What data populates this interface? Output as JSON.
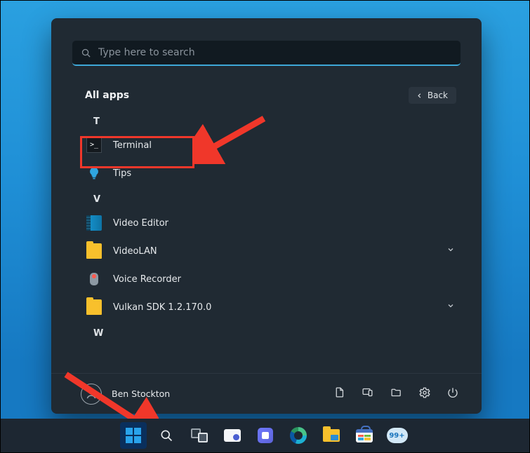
{
  "search": {
    "placeholder": "Type here to search"
  },
  "heading": "All apps",
  "back_label": "Back",
  "sections": {
    "t": {
      "letter": "T",
      "items": [
        {
          "name": "Terminal",
          "icon": "terminal-icon"
        },
        {
          "name": "Tips",
          "icon": "tips-icon"
        }
      ]
    },
    "v": {
      "letter": "V",
      "items": [
        {
          "name": "Video Editor",
          "icon": "video-editor-icon"
        },
        {
          "name": "VideoLAN",
          "icon": "folder-icon",
          "expandable": true
        },
        {
          "name": "Voice Recorder",
          "icon": "voice-recorder-icon"
        },
        {
          "name": "Vulkan SDK 1.2.170.0",
          "icon": "folder-icon",
          "expandable": true
        }
      ]
    },
    "w": {
      "letter": "W"
    }
  },
  "user": {
    "name": "Ben Stockton"
  },
  "footer_icons": [
    "documents-icon",
    "connected-devices-icon",
    "pictures-folder-icon",
    "settings-icon",
    "power-icon"
  ],
  "taskbar": {
    "items": [
      "start-icon",
      "search-icon",
      "task-view-icon",
      "whiteboard-icon",
      "chat-icon",
      "edge-icon",
      "file-explorer-icon",
      "microsoft-store-icon",
      "mail-icon"
    ],
    "mail_badge": "99+"
  },
  "annotation": {
    "arrow_to": "Terminal",
    "second_arrow_to": "start-icon"
  }
}
